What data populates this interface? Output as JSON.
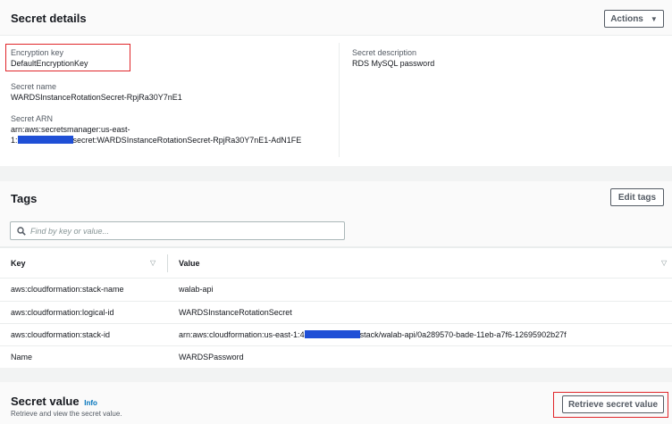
{
  "secret_details": {
    "title": "Secret details",
    "actions_label": "Actions",
    "encryption_key_label": "Encryption key",
    "encryption_key_value": "DefaultEncryptionKey",
    "secret_name_label": "Secret name",
    "secret_name_value": "WARDSInstanceRotationSecret-RpjRa30Y7nE1",
    "secret_arn_label": "Secret ARN",
    "secret_arn_line1": "arn:aws:secretsmanager:us-east-",
    "secret_arn_line2_prefix": "1:",
    "secret_arn_line2_suffix": "secret:WARDSInstanceRotationSecret-RpjRa30Y7nE1-AdN1FE",
    "description_label": "Secret description",
    "description_value": "RDS MySQL password"
  },
  "tags": {
    "title": "Tags",
    "edit_label": "Edit tags",
    "search_placeholder": "Find by key or value...",
    "columns": [
      "Key",
      "Value"
    ],
    "rows": [
      {
        "key": "aws:cloudformation:stack-name",
        "value": "walab-api"
      },
      {
        "key": "aws:cloudformation:logical-id",
        "value": "WARDSInstanceRotationSecret"
      },
      {
        "key": "aws:cloudformation:stack-id",
        "value_prefix": "arn:aws:cloudformation:us-east-1:4",
        "value_suffix": "stack/walab-api/0a289570-bade-11eb-a7f6-12695902b27f"
      },
      {
        "key": "Name",
        "value": "WARDSPassword"
      }
    ]
  },
  "secret_value": {
    "title": "Secret value",
    "info_label": "Info",
    "subtitle": "Retrieve and view the secret value.",
    "retrieve_label": "Retrieve secret value"
  },
  "icons": {
    "caret": "caret-down-icon",
    "search": "search-icon",
    "sort": "sort-icon"
  },
  "colors": {
    "highlight_box": "#e0262a",
    "redaction": "#1f4fd6",
    "info_link": "#0073bb"
  }
}
